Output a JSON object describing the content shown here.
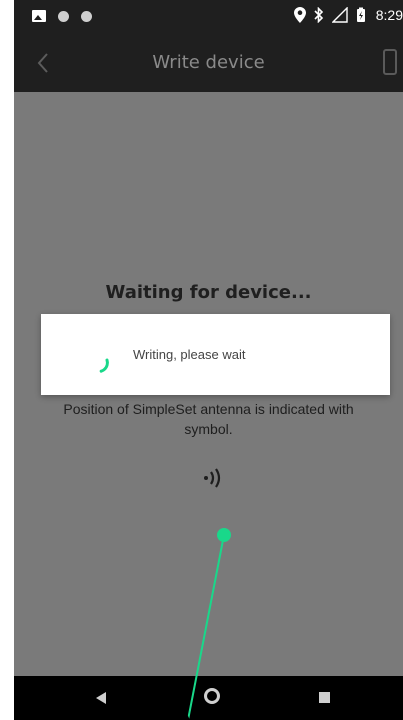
{
  "status_bar": {
    "time": "8:29",
    "icons": [
      "image-icon",
      "circle-dot-icon",
      "circle-dot-icon",
      "location-pin-icon",
      "bluetooth-icon",
      "signal-icon",
      "battery-charging-icon"
    ]
  },
  "app_bar": {
    "title": "Write device",
    "back_icon": "chevron-left-icon",
    "action_icon": "phone-device-icon"
  },
  "content": {
    "waiting_title": "Waiting for device...",
    "hint_line1": "Position of SimpleSet antenna is indicated with",
    "hint_line2": "symbol.",
    "antenna_icon": "antenna-signal-icon"
  },
  "dialog": {
    "message": "Writing, please wait"
  },
  "colors": {
    "accent": "#19d88a",
    "app_bar": "#1f1f1f",
    "content_bg": "#7a7a7a",
    "nav_bar": "#000000"
  },
  "nav_bar": {
    "icons": [
      "nav-back-icon",
      "nav-home-icon",
      "nav-recents-icon"
    ]
  }
}
